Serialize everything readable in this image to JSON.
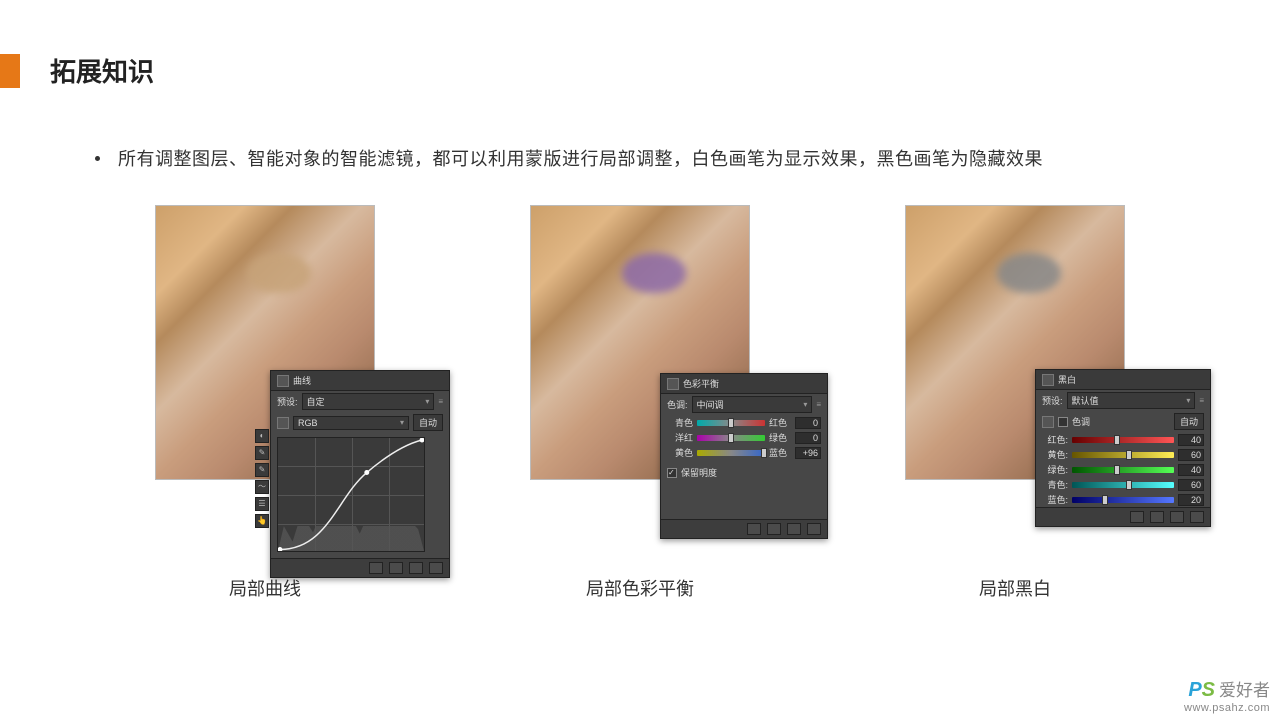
{
  "title": "拓展知识",
  "bullet": "所有调整图层、智能对象的智能滤镜，都可以利用蒙版进行局部调整，白色画笔为显示效果，黑色画笔为隐藏效果",
  "captions": [
    "局部曲线",
    "局部色彩平衡",
    "局部黑白"
  ],
  "curves": {
    "name": "曲线",
    "preset_label": "预设:",
    "preset_value": "自定",
    "channel_value": "RGB",
    "auto": "自动"
  },
  "colorbal": {
    "name": "色彩平衡",
    "tone_label": "色调:",
    "tone_value": "中间调",
    "rows": [
      {
        "left": "青色",
        "right": "红色",
        "value": "0",
        "grad": "grad-red"
      },
      {
        "left": "洋红",
        "right": "绿色",
        "value": "0",
        "grad": "grad-green"
      },
      {
        "left": "黄色",
        "right": "蓝色",
        "value": "+96",
        "grad": "grad-blue"
      }
    ],
    "preserve": "保留明度"
  },
  "bw": {
    "name": "黑白",
    "preset_label": "预设:",
    "preset_value": "默认值",
    "tint_label": "色调",
    "auto": "自动",
    "rows": [
      {
        "label": "红色:",
        "value": "40",
        "grad": "grad-bw-red",
        "pos": 40
      },
      {
        "label": "黄色:",
        "value": "60",
        "grad": "grad-bw-yel",
        "pos": 60
      },
      {
        "label": "绿色:",
        "value": "40",
        "grad": "grad-bw-grn",
        "pos": 40
      },
      {
        "label": "青色:",
        "value": "60",
        "grad": "grad-bw-cyn",
        "pos": 60
      },
      {
        "label": "蓝色:",
        "value": "20",
        "grad": "grad-bw-blu",
        "pos": 20
      }
    ]
  },
  "watermark": {
    "brand_p": "P",
    "brand_s": "S",
    "brand_cn": "爱好者",
    "url": "www.psahz.com"
  }
}
